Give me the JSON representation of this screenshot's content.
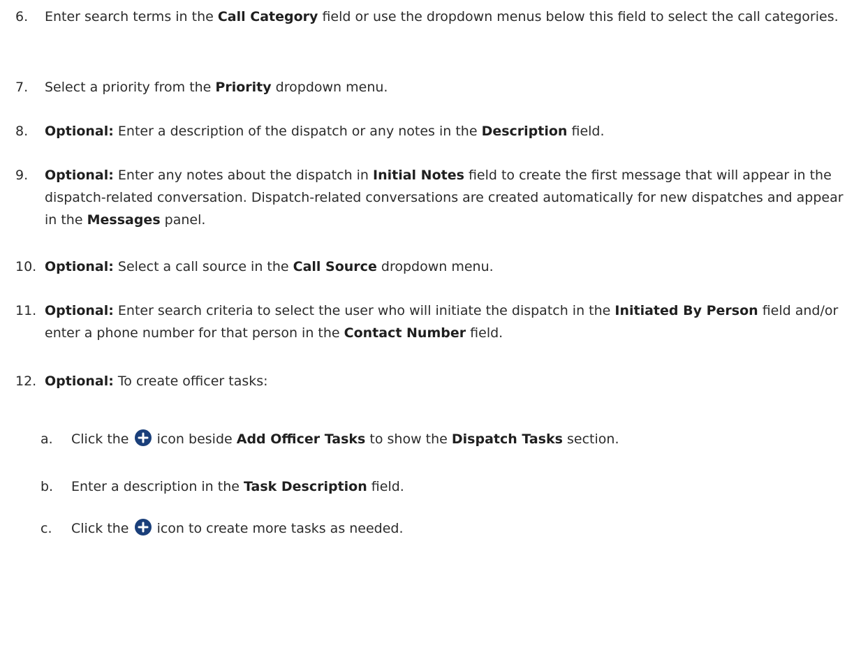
{
  "steps": [
    {
      "num": "6.",
      "parts": [
        "Enter search terms in the ",
        {
          "b": "Call Category"
        },
        " field or use the dropdown menus below this field to select the call categories."
      ]
    },
    {
      "num": "7.",
      "parts": [
        "Select a priority from the ",
        {
          "b": "Priority"
        },
        " dropdown menu."
      ]
    },
    {
      "num": "8.",
      "parts": [
        {
          "b": "Optional:"
        },
        " Enter a description of the dispatch or any notes in the ",
        {
          "b": "Description"
        },
        " field."
      ]
    },
    {
      "num": "9.",
      "parts": [
        {
          "b": "Optional:"
        },
        " Enter any notes about the dispatch in ",
        {
          "b": "Initial Notes"
        },
        " field to create the first message that will appear in the dispatch-related conversation. Dispatch-related conversations are created automatically for new dispatches and appear in the ",
        {
          "b": "Messages"
        },
        " panel."
      ]
    },
    {
      "num": "10.",
      "parts": [
        {
          "b": "Optional:"
        },
        " Select a call source in the ",
        {
          "b": "Call Source"
        },
        " dropdown menu."
      ]
    },
    {
      "num": "11.",
      "parts": [
        {
          "b": "Optional:"
        },
        " Enter search criteria to select the user who will initiate the dispatch in the ",
        {
          "b": "Initiated By Person"
        },
        " field and/or enter a phone number for that person in the ",
        {
          "b": "Contact Number"
        },
        " field."
      ]
    },
    {
      "num": "12.",
      "parts": [
        {
          "b": "Optional:"
        },
        " To create officer tasks:"
      ]
    }
  ],
  "substeps": [
    {
      "num": "a.",
      "parts": [
        "Click the ",
        {
          "icon": "plus-circle-icon"
        },
        " icon beside ",
        {
          "b": "Add Officer Tasks"
        },
        " to show the ",
        {
          "b": "Dispatch Tasks"
        },
        " section."
      ]
    },
    {
      "num": "b.",
      "parts": [
        "Enter a description in the ",
        {
          "b": "Task Description"
        },
        " field."
      ]
    },
    {
      "num": "c.",
      "parts": [
        "Click the ",
        {
          "icon": "plus-circle-icon"
        },
        " icon to create more tasks as needed."
      ]
    }
  ],
  "icon_color": "#1a3f7a"
}
